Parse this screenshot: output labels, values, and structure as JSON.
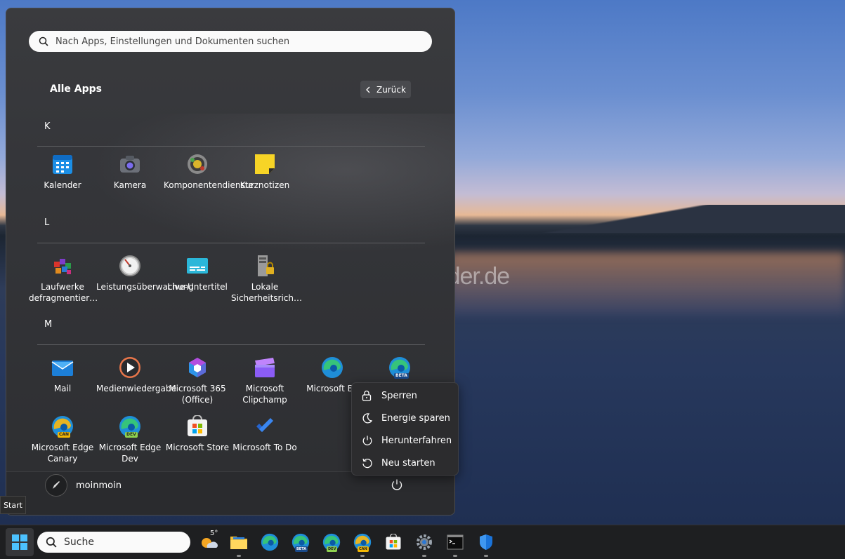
{
  "start_menu": {
    "search_placeholder": "Nach Apps, Einstellungen und Dokumenten suchen",
    "title": "Alle Apps",
    "back_label": "Zurück",
    "groups": [
      {
        "letter": "K",
        "apps": [
          {
            "label": "Kalender",
            "icon": "calendar-icon"
          },
          {
            "label": "Kamera",
            "icon": "camera-icon"
          },
          {
            "label": "Komponentendienste",
            "icon": "component-services-icon"
          },
          {
            "label": "Kurznotizen",
            "icon": "sticky-notes-icon"
          }
        ]
      },
      {
        "letter": "L",
        "apps": [
          {
            "label": "Laufwerke defragmentier…",
            "icon": "defrag-icon"
          },
          {
            "label": "Leistungsüberwachung",
            "icon": "performance-monitor-icon"
          },
          {
            "label": "Live-Untertitel",
            "icon": "live-captions-icon"
          },
          {
            "label": "Lokale Sicherheitsrich…",
            "icon": "local-security-policy-icon"
          }
        ]
      },
      {
        "letter": "M",
        "apps": [
          {
            "label": "Mail",
            "icon": "mail-icon"
          },
          {
            "label": "Medienwiedergabe",
            "icon": "media-player-icon"
          },
          {
            "label": "Microsoft 365 (Office)",
            "icon": "m365-icon"
          },
          {
            "label": "Microsoft Clipchamp",
            "icon": "clipchamp-icon"
          },
          {
            "label": "Microsoft Ed",
            "icon": "edge-icon"
          },
          {
            "label": "",
            "icon": "edge-beta-icon"
          },
          {
            "label": "Microsoft Edge Canary",
            "icon": "edge-canary-icon"
          },
          {
            "label": "Microsoft Edge Dev",
            "icon": "edge-dev-icon"
          },
          {
            "label": "Microsoft Store",
            "icon": "store-icon"
          },
          {
            "label": "Microsoft To Do",
            "icon": "todo-icon"
          }
        ]
      }
    ],
    "user": {
      "name": "moinmoin"
    },
    "power_menu": [
      {
        "label": "Sperren",
        "icon": "lock-icon"
      },
      {
        "label": "Energie sparen",
        "icon": "sleep-icon"
      },
      {
        "label": "Herunterfahren",
        "icon": "power-icon"
      },
      {
        "label": "Neu starten",
        "icon": "restart-icon"
      }
    ]
  },
  "tooltip": "Start",
  "watermark": "Deskmodder.de",
  "taskbar": {
    "search_label": "Suche",
    "weather_temp": "5°",
    "badges": {
      "beta": "BETA",
      "dev": "DEV",
      "can": "CAN"
    },
    "icons": [
      "weather-icon",
      "file-explorer-icon",
      "edge-icon",
      "edge-beta-icon",
      "edge-dev-icon",
      "edge-canary-icon",
      "store-icon",
      "settings-icon",
      "terminal-icon",
      "defender-icon"
    ]
  }
}
